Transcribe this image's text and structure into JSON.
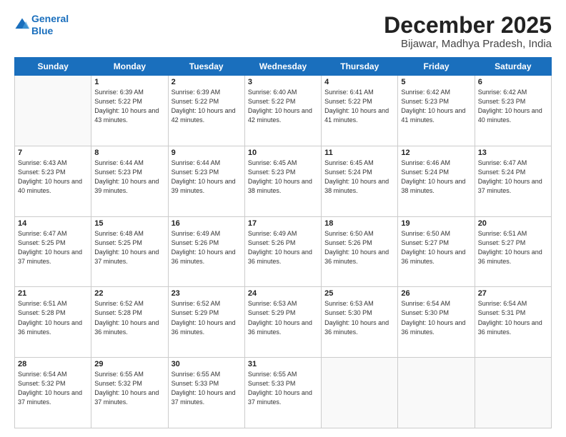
{
  "logo": {
    "line1": "General",
    "line2": "Blue"
  },
  "title": "December 2025",
  "subtitle": "Bijawar, Madhya Pradesh, India",
  "weekdays": [
    "Sunday",
    "Monday",
    "Tuesday",
    "Wednesday",
    "Thursday",
    "Friday",
    "Saturday"
  ],
  "weeks": [
    [
      {
        "day": "",
        "info": ""
      },
      {
        "day": "1",
        "info": "Sunrise: 6:39 AM\nSunset: 5:22 PM\nDaylight: 10 hours\nand 43 minutes."
      },
      {
        "day": "2",
        "info": "Sunrise: 6:39 AM\nSunset: 5:22 PM\nDaylight: 10 hours\nand 42 minutes."
      },
      {
        "day": "3",
        "info": "Sunrise: 6:40 AM\nSunset: 5:22 PM\nDaylight: 10 hours\nand 42 minutes."
      },
      {
        "day": "4",
        "info": "Sunrise: 6:41 AM\nSunset: 5:22 PM\nDaylight: 10 hours\nand 41 minutes."
      },
      {
        "day": "5",
        "info": "Sunrise: 6:42 AM\nSunset: 5:23 PM\nDaylight: 10 hours\nand 41 minutes."
      },
      {
        "day": "6",
        "info": "Sunrise: 6:42 AM\nSunset: 5:23 PM\nDaylight: 10 hours\nand 40 minutes."
      }
    ],
    [
      {
        "day": "7",
        "info": "Sunrise: 6:43 AM\nSunset: 5:23 PM\nDaylight: 10 hours\nand 40 minutes."
      },
      {
        "day": "8",
        "info": "Sunrise: 6:44 AM\nSunset: 5:23 PM\nDaylight: 10 hours\nand 39 minutes."
      },
      {
        "day": "9",
        "info": "Sunrise: 6:44 AM\nSunset: 5:23 PM\nDaylight: 10 hours\nand 39 minutes."
      },
      {
        "day": "10",
        "info": "Sunrise: 6:45 AM\nSunset: 5:23 PM\nDaylight: 10 hours\nand 38 minutes."
      },
      {
        "day": "11",
        "info": "Sunrise: 6:45 AM\nSunset: 5:24 PM\nDaylight: 10 hours\nand 38 minutes."
      },
      {
        "day": "12",
        "info": "Sunrise: 6:46 AM\nSunset: 5:24 PM\nDaylight: 10 hours\nand 38 minutes."
      },
      {
        "day": "13",
        "info": "Sunrise: 6:47 AM\nSunset: 5:24 PM\nDaylight: 10 hours\nand 37 minutes."
      }
    ],
    [
      {
        "day": "14",
        "info": "Sunrise: 6:47 AM\nSunset: 5:25 PM\nDaylight: 10 hours\nand 37 minutes."
      },
      {
        "day": "15",
        "info": "Sunrise: 6:48 AM\nSunset: 5:25 PM\nDaylight: 10 hours\nand 37 minutes."
      },
      {
        "day": "16",
        "info": "Sunrise: 6:49 AM\nSunset: 5:26 PM\nDaylight: 10 hours\nand 36 minutes."
      },
      {
        "day": "17",
        "info": "Sunrise: 6:49 AM\nSunset: 5:26 PM\nDaylight: 10 hours\nand 36 minutes."
      },
      {
        "day": "18",
        "info": "Sunrise: 6:50 AM\nSunset: 5:26 PM\nDaylight: 10 hours\nand 36 minutes."
      },
      {
        "day": "19",
        "info": "Sunrise: 6:50 AM\nSunset: 5:27 PM\nDaylight: 10 hours\nand 36 minutes."
      },
      {
        "day": "20",
        "info": "Sunrise: 6:51 AM\nSunset: 5:27 PM\nDaylight: 10 hours\nand 36 minutes."
      }
    ],
    [
      {
        "day": "21",
        "info": "Sunrise: 6:51 AM\nSunset: 5:28 PM\nDaylight: 10 hours\nand 36 minutes."
      },
      {
        "day": "22",
        "info": "Sunrise: 6:52 AM\nSunset: 5:28 PM\nDaylight: 10 hours\nand 36 minutes."
      },
      {
        "day": "23",
        "info": "Sunrise: 6:52 AM\nSunset: 5:29 PM\nDaylight: 10 hours\nand 36 minutes."
      },
      {
        "day": "24",
        "info": "Sunrise: 6:53 AM\nSunset: 5:29 PM\nDaylight: 10 hours\nand 36 minutes."
      },
      {
        "day": "25",
        "info": "Sunrise: 6:53 AM\nSunset: 5:30 PM\nDaylight: 10 hours\nand 36 minutes."
      },
      {
        "day": "26",
        "info": "Sunrise: 6:54 AM\nSunset: 5:30 PM\nDaylight: 10 hours\nand 36 minutes."
      },
      {
        "day": "27",
        "info": "Sunrise: 6:54 AM\nSunset: 5:31 PM\nDaylight: 10 hours\nand 36 minutes."
      }
    ],
    [
      {
        "day": "28",
        "info": "Sunrise: 6:54 AM\nSunset: 5:32 PM\nDaylight: 10 hours\nand 37 minutes."
      },
      {
        "day": "29",
        "info": "Sunrise: 6:55 AM\nSunset: 5:32 PM\nDaylight: 10 hours\nand 37 minutes."
      },
      {
        "day": "30",
        "info": "Sunrise: 6:55 AM\nSunset: 5:33 PM\nDaylight: 10 hours\nand 37 minutes."
      },
      {
        "day": "31",
        "info": "Sunrise: 6:55 AM\nSunset: 5:33 PM\nDaylight: 10 hours\nand 37 minutes."
      },
      {
        "day": "",
        "info": ""
      },
      {
        "day": "",
        "info": ""
      },
      {
        "day": "",
        "info": ""
      }
    ]
  ]
}
